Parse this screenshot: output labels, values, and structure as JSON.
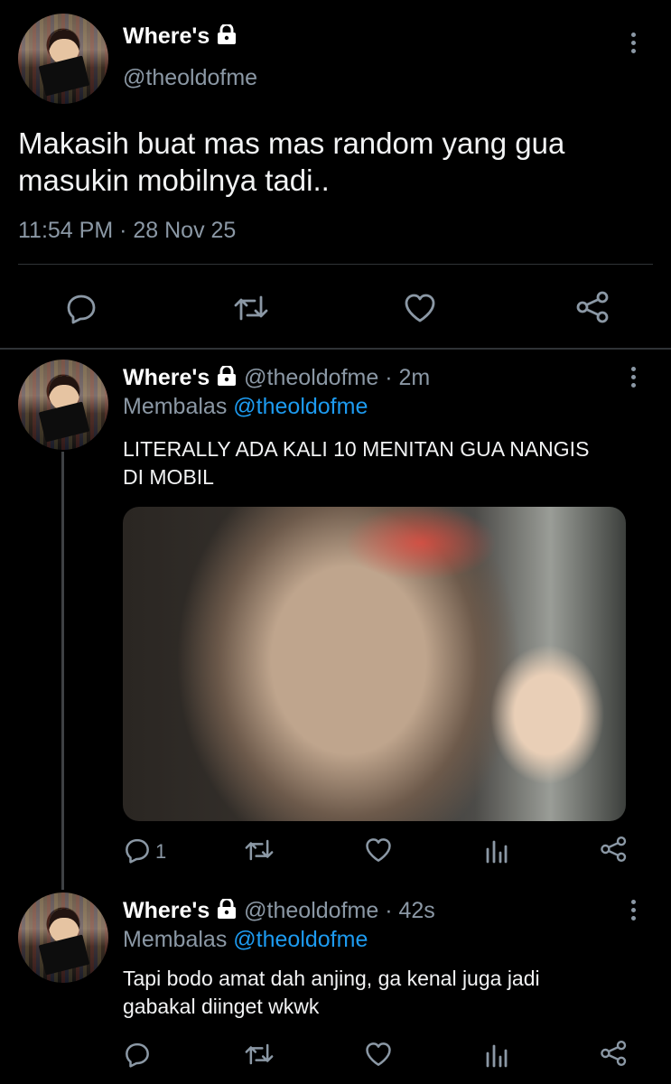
{
  "main_tweet": {
    "display_name": "Where's",
    "handle": "@theoldofme",
    "text_line1": "Makasih buat mas mas random yang gua",
    "text_line2": "masukin mobilnya tadi..",
    "meta": "11:54 PM · 28 Nov 25"
  },
  "replies": [
    {
      "display_name": "Where's",
      "handle": "@theoldofme",
      "time": "· 2m",
      "replying_prefix": "Membalas",
      "replying_to": "@theoldofme",
      "text_line1": "LITERALLY ADA KALI 10 MENITAN GUA NANGIS",
      "text_line2": "DI MOBIL",
      "reply_count": "1"
    },
    {
      "display_name": "Where's",
      "handle": "@theoldofme",
      "time": "· 42s",
      "replying_prefix": "Membalas",
      "replying_to": "@theoldofme",
      "text_line1": "Tapi bodo amat dah anjing, ga kenal juga jadi",
      "text_line2": "gabakal diinget wkwk",
      "reply_count": ""
    }
  ],
  "colors": {
    "background": "#000000",
    "text": "#e7e9ea",
    "secondary": "#8b98a5",
    "link": "#1d9bf0",
    "divider": "#2f3336"
  },
  "icons": [
    "lock-icon",
    "more-icon",
    "reply-icon",
    "retweet-icon",
    "like-icon",
    "share-icon",
    "analytics-icon"
  ]
}
